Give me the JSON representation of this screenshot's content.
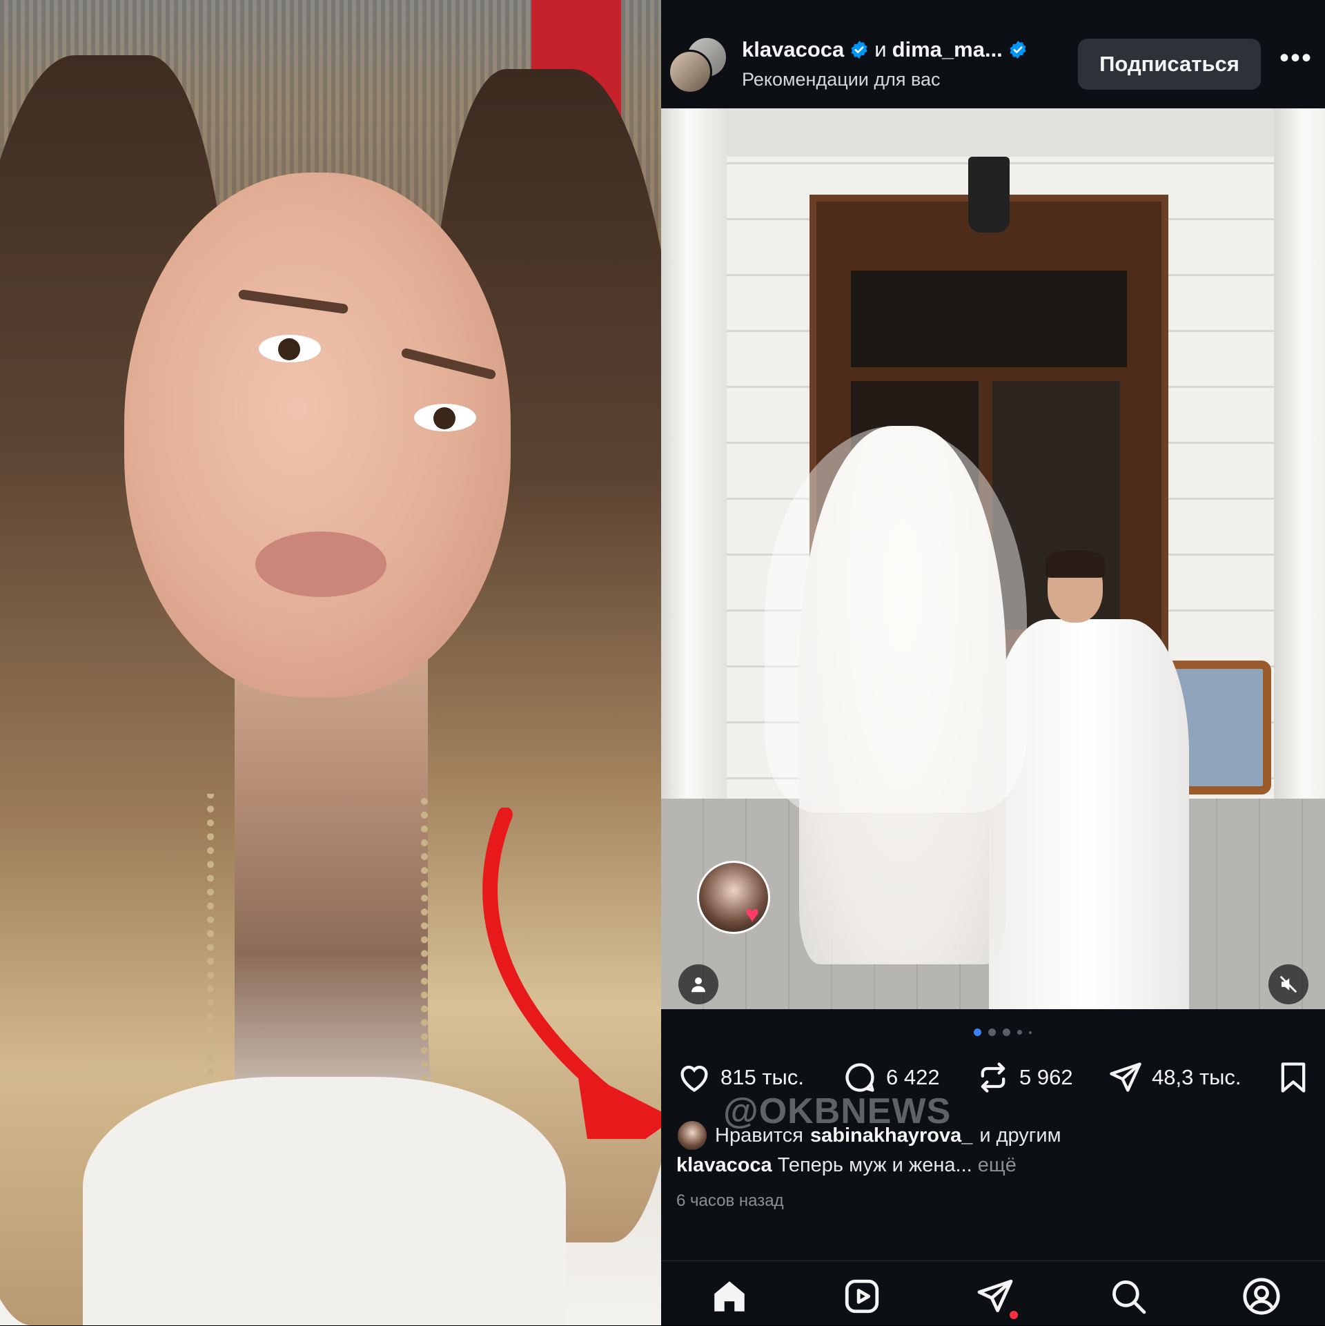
{
  "left_panel": {
    "description_icon": "selfie-photo"
  },
  "header": {
    "user1": "klavacoca",
    "conjunction": "и",
    "user2": "dima_ma...",
    "subtitle": "Рекомендации для вас",
    "follow_label": "Подписаться",
    "more_label": "•••"
  },
  "post": {
    "liker_badge_icon": "heart-icon",
    "carousel": {
      "count": 5,
      "active_index": 0
    }
  },
  "actions": {
    "likes": "815 тыс.",
    "comments": "6 422",
    "reposts": "5 962",
    "shares": "48,3 тыс."
  },
  "watermark": "@OKBNEWS",
  "likes_line": {
    "prefix": "Нравится",
    "user": "sabinakhayrova_",
    "suffix": "и другим"
  },
  "caption": {
    "user": "klavacoca",
    "text": "Теперь муж и жена...",
    "more": "ещё"
  },
  "timestamp": "6 часов назад",
  "colors": {
    "background": "#0c1014",
    "verified": "#0095f6",
    "accent_dot": "#3b82f6",
    "notification": "#ff2f40",
    "arrow": "#e8191b"
  }
}
